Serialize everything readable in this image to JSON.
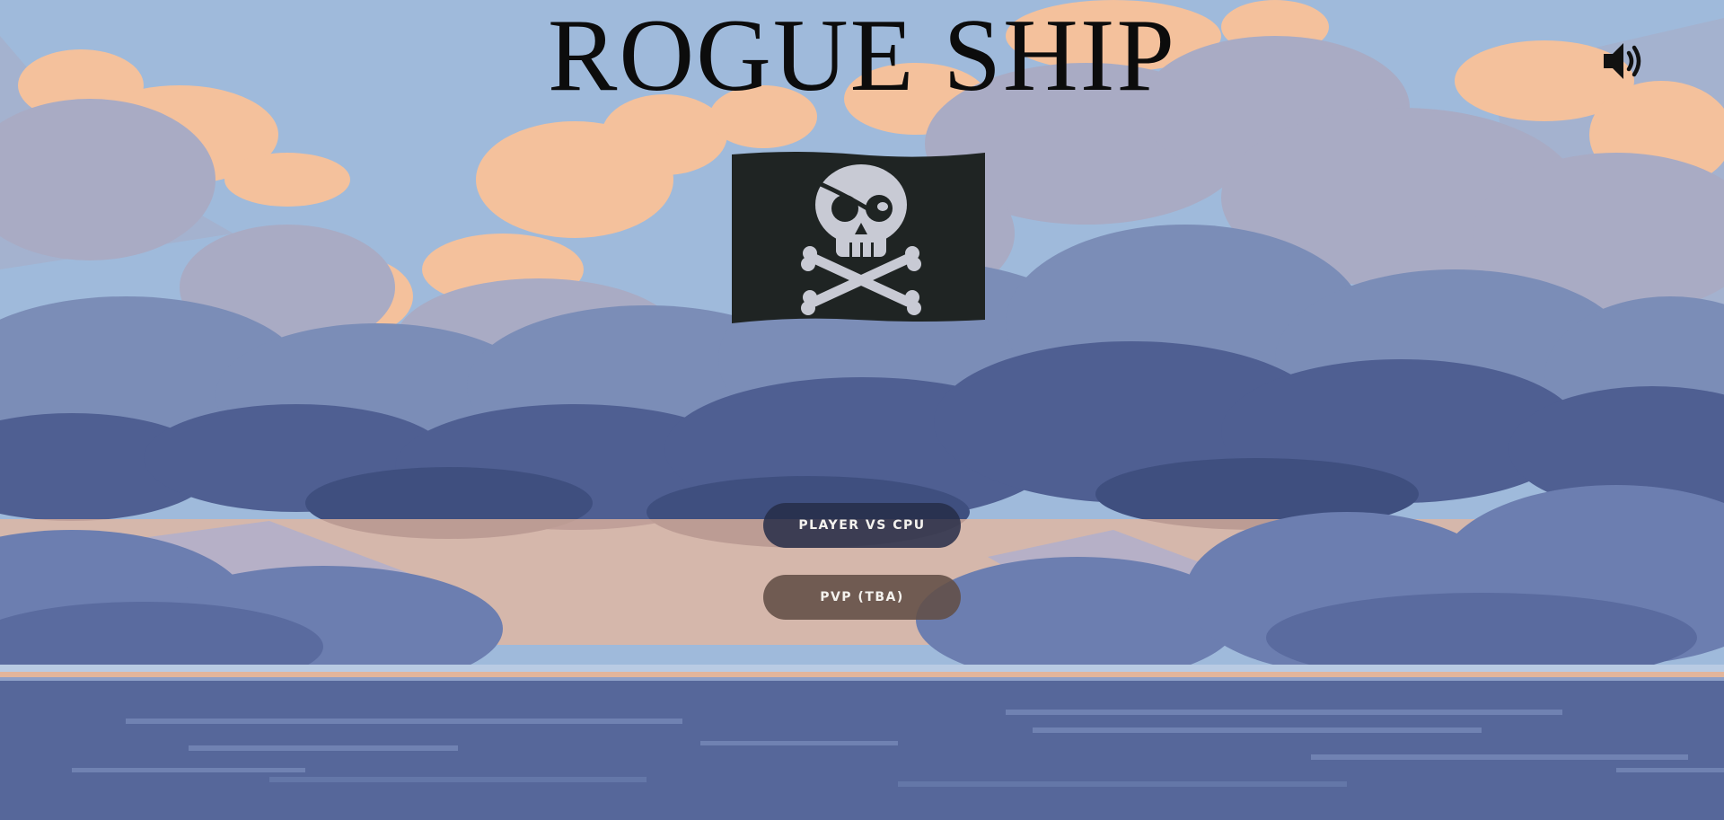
{
  "game": {
    "title": "ROGUE SHIP"
  },
  "menu": {
    "player_vs_cpu_label": "PLAYER VS CPU",
    "pvp_label": "PVP (TBA)"
  },
  "icons": {
    "sound": "speaker-volume-icon",
    "flag": "jolly-roger-flag-icon"
  },
  "colors": {
    "sky": "#9fbadb",
    "cloud_peach": "#f4c19c",
    "cloud_blue": "#55689b",
    "sea": "#56679a",
    "flag": "#1f2423",
    "button_cpu": "#262d48",
    "button_pvp": "#624e46"
  }
}
